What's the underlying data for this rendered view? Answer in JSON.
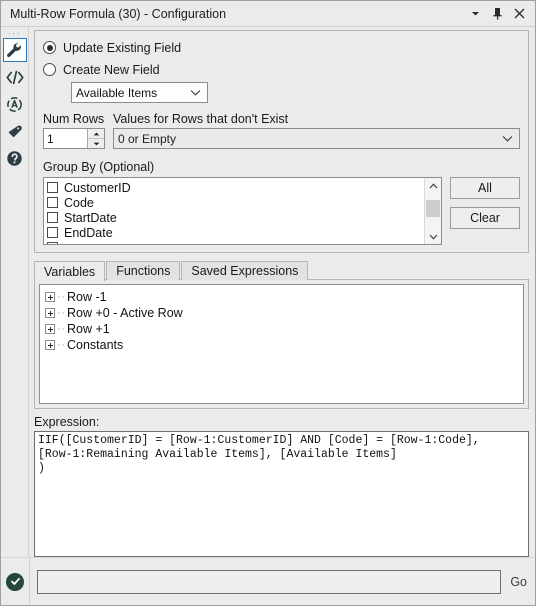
{
  "window": {
    "title": "Multi-Row Formula (30) - Configuration",
    "controls": [
      {
        "name": "menu-caret-icon",
        "label": "▾"
      },
      {
        "name": "pin-icon",
        "label": "pin"
      },
      {
        "name": "close-icon",
        "label": "✕"
      }
    ]
  },
  "rail": {
    "grip": "···",
    "icons": [
      {
        "name": "wrench-icon",
        "label": "Configuration",
        "selected": true
      },
      {
        "name": "code-icon",
        "label": "XML View",
        "selected": false
      },
      {
        "name": "annotation-icon",
        "label": "Annotation",
        "selected": false
      },
      {
        "name": "tag-icon",
        "label": "Label",
        "selected": false
      },
      {
        "name": "help-icon",
        "label": "Help",
        "selected": false
      }
    ]
  },
  "options": {
    "update_existing_label": "Update Existing Field",
    "create_new_label": "Create New  Field",
    "update_existing_selected": true,
    "create_new_selected": false,
    "field_select_value": "Available Items",
    "num_rows_label": "Num Rows",
    "num_rows_value": "1",
    "missing_values_label": "Values for Rows that don't Exist",
    "missing_values_value": "0 or Empty"
  },
  "group_by": {
    "title": "Group By (Optional)",
    "items": [
      {
        "label": "CustomerID",
        "checked": false
      },
      {
        "label": "Code",
        "checked": false
      },
      {
        "label": "StartDate",
        "checked": false
      },
      {
        "label": "EndDate",
        "checked": false
      }
    ],
    "all_button": "All",
    "clear_button": "Clear"
  },
  "tabs": [
    {
      "label": "Variables",
      "active": true
    },
    {
      "label": "Functions",
      "active": false
    },
    {
      "label": "Saved Expressions",
      "active": false
    }
  ],
  "variables_tree": [
    {
      "label": "Row -1"
    },
    {
      "label": "Row +0 - Active Row"
    },
    {
      "label": "Row +1"
    },
    {
      "label": "Constants"
    }
  ],
  "expression": {
    "label": "Expression:",
    "text": "IIF([CustomerID] = [Row-1:CustomerID] AND [Code] = [Row-1:Code],\n[Row-1:Remaining Available Items], [Available Items]\n)"
  },
  "footer": {
    "status": "valid",
    "search_value": "",
    "go_label": "Go"
  },
  "colors": {
    "window_bg": "#ebebeb",
    "accent_selected": "#2a7ac0",
    "icon": "#2c3e43",
    "status_ok": "#24473f",
    "field_bg": "#ffffff"
  }
}
